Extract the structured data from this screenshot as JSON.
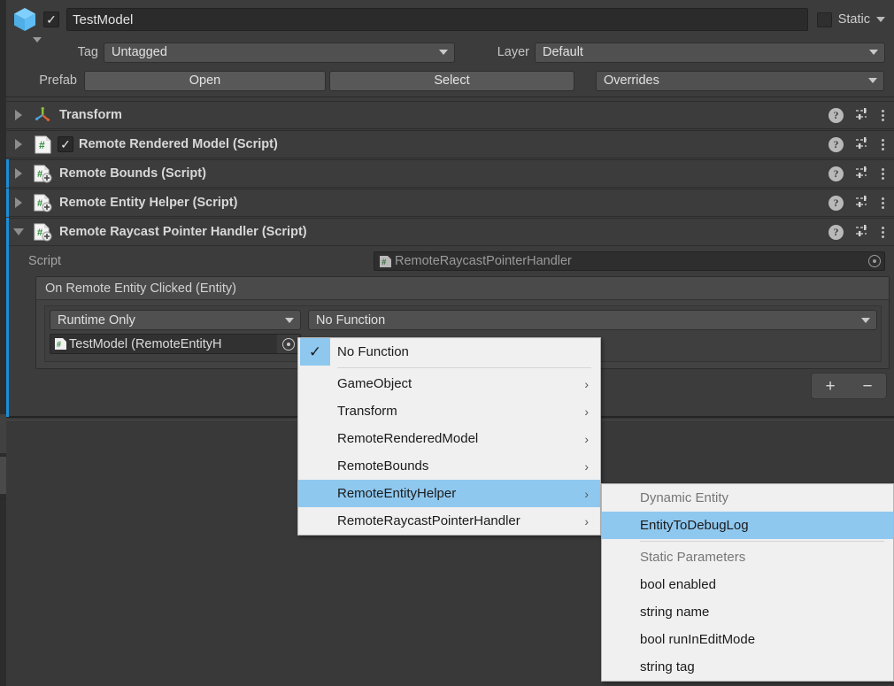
{
  "header": {
    "active_checkbox_checked": true,
    "object_name": "TestModel",
    "static_label": "Static",
    "tag_label": "Tag",
    "tag_value": "Untagged",
    "layer_label": "Layer",
    "layer_value": "Default",
    "prefab_label": "Prefab",
    "prefab_open": "Open",
    "prefab_select": "Select",
    "prefab_overrides": "Overrides"
  },
  "components": [
    {
      "title": "Transform",
      "icon": "transform-axis-icon",
      "expanded": false,
      "has_enable_checkbox": false,
      "selected": false
    },
    {
      "title": "Remote Rendered Model (Script)",
      "icon": "script-icon",
      "expanded": false,
      "has_enable_checkbox": true,
      "enabled": true,
      "selected": false
    },
    {
      "title": "Remote Bounds (Script)",
      "icon": "script-add-icon",
      "expanded": false,
      "has_enable_checkbox": false,
      "selected": true
    },
    {
      "title": "Remote Entity Helper (Script)",
      "icon": "script-add-icon",
      "expanded": false,
      "has_enable_checkbox": false,
      "selected": true
    },
    {
      "title": "Remote Raycast Pointer Handler (Script)",
      "icon": "script-add-icon",
      "expanded": true,
      "has_enable_checkbox": false,
      "selected": true
    }
  ],
  "body": {
    "script_label": "Script",
    "script_value": "RemoteRaycastPointerHandler",
    "event_title": "On Remote Entity Clicked (Entity)",
    "callback_mode": "Runtime Only",
    "callback_function": "No Function",
    "callback_object": "TestModel (RemoteEntityH",
    "add_button": "+",
    "remove_button": "−"
  },
  "menu": {
    "main_items": [
      {
        "label": "No Function",
        "checked": true,
        "submenu": false,
        "highlighted": false
      },
      {
        "label": "GameObject",
        "checked": false,
        "submenu": true,
        "highlighted": false
      },
      {
        "label": "Transform",
        "checked": false,
        "submenu": true,
        "highlighted": false
      },
      {
        "label": "RemoteRenderedModel",
        "checked": false,
        "submenu": true,
        "highlighted": false
      },
      {
        "label": "RemoteBounds",
        "checked": false,
        "submenu": true,
        "highlighted": false
      },
      {
        "label": "RemoteEntityHelper",
        "checked": false,
        "submenu": true,
        "highlighted": true
      },
      {
        "label": "RemoteRaycastPointerHandler",
        "checked": false,
        "submenu": true,
        "highlighted": false
      }
    ],
    "sub_items": [
      {
        "label": "Dynamic Entity",
        "is_header": true,
        "highlighted": false
      },
      {
        "label": "EntityToDebugLog",
        "is_header": false,
        "highlighted": true
      },
      {
        "label": "Static Parameters",
        "is_header": true,
        "highlighted": false
      },
      {
        "label": "bool enabled",
        "is_header": false,
        "highlighted": false
      },
      {
        "label": "string name",
        "is_header": false,
        "highlighted": false
      },
      {
        "label": "bool runInEditMode",
        "is_header": false,
        "highlighted": false
      },
      {
        "label": "string tag",
        "is_header": false,
        "highlighted": false
      }
    ]
  },
  "icons": {
    "check": "✓",
    "submenu_arrow": "›",
    "help": "?",
    "preset": "preset-sliders-icon",
    "kebab": "kebab-menu-icon"
  },
  "colors": {
    "accent_blue": "#1d8dd6",
    "menu_highlight": "#8fc8ef",
    "panel_bg": "#3c3c3c",
    "cube_icon": "#5fbdf5"
  }
}
